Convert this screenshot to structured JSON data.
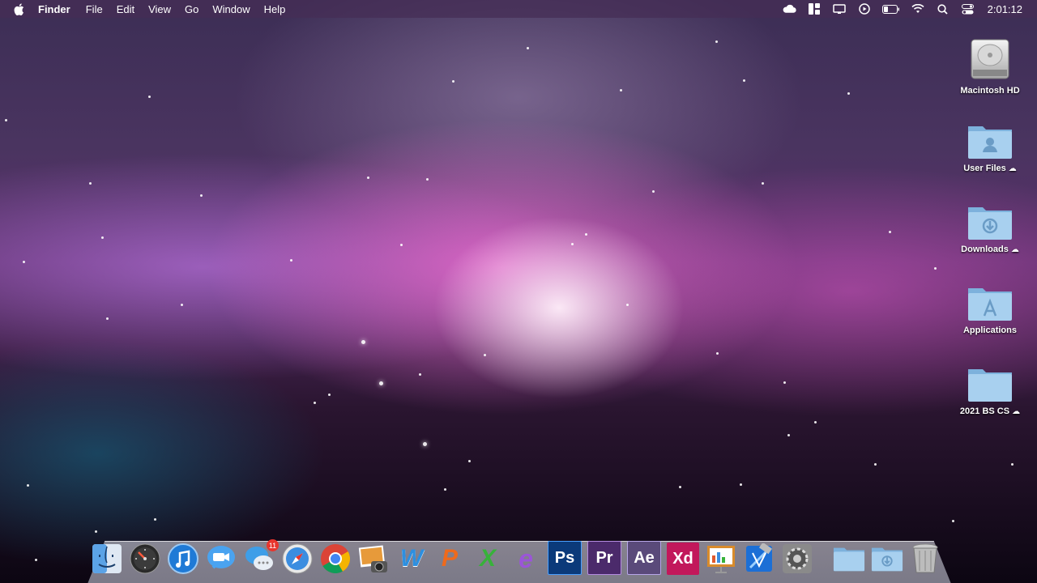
{
  "menubar": {
    "app_name": "Finder",
    "menus": [
      "File",
      "Edit",
      "View",
      "Go",
      "Window",
      "Help"
    ],
    "clock": "2:01:12",
    "status_icons": [
      "cloud-icon",
      "window-layout-icon",
      "display-icon",
      "play-icon",
      "battery-icon",
      "wifi-icon",
      "search-icon",
      "control-center-icon"
    ]
  },
  "desktop": {
    "icons": [
      {
        "label": "Macintosh HD",
        "kind": "hard-drive",
        "cloud": false
      },
      {
        "label": "User Files",
        "kind": "folder-user",
        "cloud": true
      },
      {
        "label": "Downloads",
        "kind": "folder-downloads",
        "cloud": true
      },
      {
        "label": "Applications",
        "kind": "folder-applications",
        "cloud": false
      },
      {
        "label": "2021 BS CS",
        "kind": "folder",
        "cloud": true
      }
    ]
  },
  "dock": {
    "apps": [
      {
        "name": "Finder",
        "icon": "finder-icon"
      },
      {
        "name": "Dashboard",
        "icon": "dashboard-icon"
      },
      {
        "name": "iTunes",
        "icon": "itunes-icon"
      },
      {
        "name": "FaceTime",
        "icon": "facetime-icon"
      },
      {
        "name": "Messages",
        "icon": "messages-icon",
        "badge": "11"
      },
      {
        "name": "Safari",
        "icon": "safari-icon"
      },
      {
        "name": "Chrome",
        "icon": "chrome-icon"
      },
      {
        "name": "iPhoto",
        "icon": "iphoto-icon"
      },
      {
        "name": "Word",
        "icon": "word-icon",
        "glyph": "W"
      },
      {
        "name": "PowerPoint",
        "icon": "powerpoint-icon",
        "glyph": "P"
      },
      {
        "name": "Excel",
        "icon": "excel-icon",
        "glyph": "X"
      },
      {
        "name": "OneNote",
        "icon": "onenote-icon",
        "glyph": "e"
      },
      {
        "name": "Photoshop",
        "icon": "photoshop-icon",
        "glyph": "Ps"
      },
      {
        "name": "Premiere",
        "icon": "premiere-icon",
        "glyph": "Pr"
      },
      {
        "name": "After Effects",
        "icon": "aftereffects-icon",
        "glyph": "Ae"
      },
      {
        "name": "Adobe XD",
        "icon": "xd-icon",
        "glyph": "Xd"
      },
      {
        "name": "Keynote",
        "icon": "keynote-icon"
      },
      {
        "name": "Xcode",
        "icon": "xcode-icon"
      },
      {
        "name": "System Preferences",
        "icon": "settings-icon"
      }
    ],
    "stacks": [
      {
        "name": "Applications folder",
        "icon": "folder-icon"
      },
      {
        "name": "Downloads folder",
        "icon": "downloads-folder-icon"
      },
      {
        "name": "Trash",
        "icon": "trash-icon"
      }
    ]
  },
  "colors": {
    "menubar": "#462d55",
    "photoshop": "#0b3a7a",
    "premiere": "#4b2a6b",
    "aftereffects": "#5a4a7a",
    "xd": "#c2185b"
  }
}
